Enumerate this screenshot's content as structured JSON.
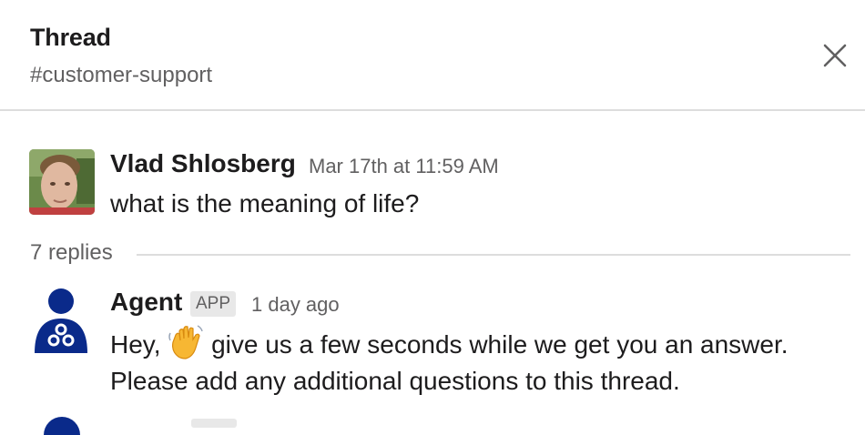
{
  "header": {
    "title": "Thread",
    "channel": "#customer-support",
    "close_icon": "close-icon"
  },
  "parent_message": {
    "author": "Vlad Shlosberg",
    "timestamp": "Mar 17th at 11:59 AM",
    "text": "what is the meaning of life?"
  },
  "replies": {
    "count_label": "7 replies"
  },
  "reply_message": {
    "author": "Agent",
    "badge": "APP",
    "timestamp": "1 day ago",
    "line1_before": "Hey,",
    "line1_emoji": "waving-hand-emoji",
    "line1_after": "give us a few seconds while we get you an answer.",
    "line2": "Please add any additional questions to this thread."
  },
  "colors": {
    "agent_avatar": "#0a2a8a",
    "text_primary": "#1d1c1d",
    "text_secondary": "#616061",
    "divider": "#dddddd",
    "badge_bg": "#e8e8e8"
  }
}
